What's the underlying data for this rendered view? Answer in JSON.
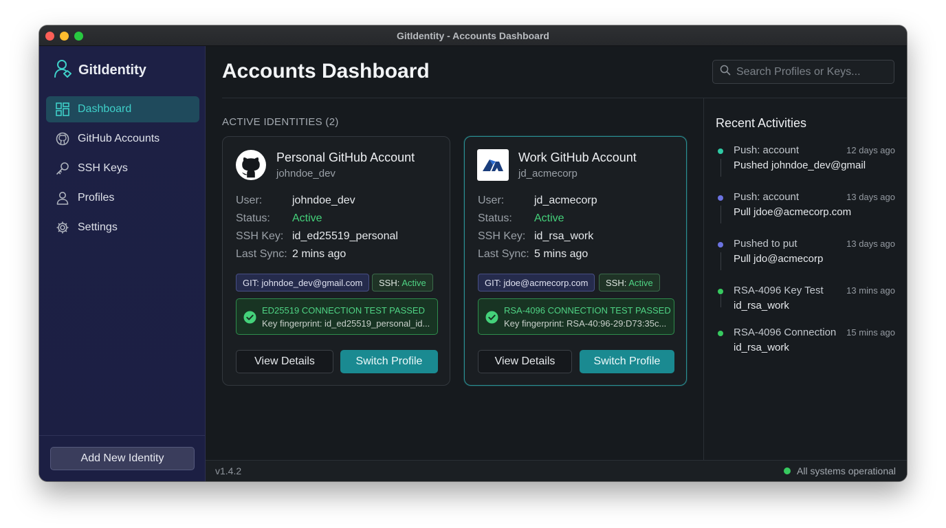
{
  "window": {
    "title": "GitIdentity - Accounts Dashboard"
  },
  "colors": {
    "accent": "#3fd0c9",
    "primary_button": "#1a8a91",
    "success": "#44d17a",
    "sidebar_bg": "#1d2045"
  },
  "sidebar": {
    "brand": "GitIdentity",
    "brand_icon": "user-shield-icon",
    "items": [
      {
        "label": "Dashboard",
        "icon": "dashboard-grid-icon",
        "active": true
      },
      {
        "label": "GitHub Accounts",
        "icon": "github-icon",
        "active": false
      },
      {
        "label": "SSH Keys",
        "icon": "key-icon",
        "active": false
      },
      {
        "label": "Profiles",
        "icon": "user-icon",
        "active": false
      },
      {
        "label": "Settings",
        "icon": "gear-icon",
        "active": false
      }
    ],
    "add_button": "Add New Identity"
  },
  "header": {
    "title": "Accounts Dashboard",
    "search_placeholder": "Search Profiles or Keys..."
  },
  "identities": {
    "section_label": "ACTIVE IDENTITIES (2)",
    "cards": [
      {
        "title": "Personal GitHub Account",
        "subtitle": "johndoe_dev",
        "icon": "github-logo-icon",
        "fields": [
          {
            "key": "User:",
            "value": "johndoe_dev"
          },
          {
            "key": "Status:",
            "value": "Active"
          },
          {
            "key": "SSH Key:",
            "value": "id_ed25519_personal"
          },
          {
            "key": "Last Sync:",
            "value": "2 mins ago"
          }
        ],
        "git_chip": "GIT: johndoe_dev@gmail.com",
        "ssh_chip_label": "SSH:",
        "ssh_chip_status": "Active",
        "test_title": "ED25519 CONNECTION TEST PASSED",
        "test_fingerprint": "Key fingerprint:  id_ed25519_personal_id...",
        "details_button": "View Details",
        "switch_button": "Switch Profile"
      },
      {
        "title": "Work GitHub Account",
        "subtitle": "jd_acmecorp",
        "icon": "acme-logo-icon",
        "fields": [
          {
            "key": "User:",
            "value": "jd_acmecorp"
          },
          {
            "key": "Status:",
            "value": "Active"
          },
          {
            "key": "SSH Key:",
            "value": "id_rsa_work"
          },
          {
            "key": "Last Sync:",
            "value": "5 mins ago"
          }
        ],
        "git_chip": "GIT: jdoe@acmecorp.com",
        "ssh_chip_label": "SSH:",
        "ssh_chip_status": "Active",
        "test_title": "RSA-4096 CONNECTION TEST PASSED",
        "test_fingerprint": "Key fingerprint: RSA-40:96-29:D73:35c...",
        "details_button": "View Details",
        "switch_button": "Switch Profile"
      }
    ]
  },
  "activities": {
    "title": "Recent Activities",
    "items": [
      {
        "line1": "Push: account",
        "line2": "Pushed johndoe_dev@gmail",
        "time": "12 days ago",
        "dot": "#2fc9a4"
      },
      {
        "line1": "Push: account",
        "line2": "Pull jdoe@acmecorp.com",
        "time": "13 days ago",
        "dot": "#6b72e0"
      },
      {
        "line1": "Pushed to put",
        "line2": "Pull jdo@acmecorp",
        "time": "13 days ago",
        "dot": "#6b72e0"
      },
      {
        "line1": "RSA-4096 Key Test",
        "line2": "id_rsa_work",
        "time": "13 mins ago",
        "dot": "#37c95f"
      },
      {
        "line1": "RSA-4096 Connection",
        "line2": "id_rsa_work",
        "time": "15 mins ago",
        "dot": "#37c95f"
      }
    ]
  },
  "footer": {
    "version": "v1.4.2",
    "status": "All systems operational"
  }
}
